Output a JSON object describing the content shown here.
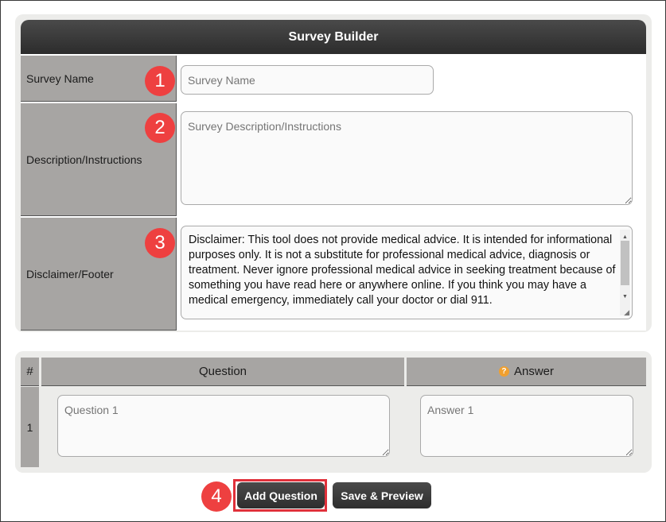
{
  "builder": {
    "title": "Survey Builder",
    "survey_name": {
      "label": "Survey Name",
      "placeholder": "Survey Name",
      "value": "",
      "badge": "1"
    },
    "description": {
      "label": "Description/Instructions",
      "placeholder": "Survey Description/Instructions",
      "value": "",
      "badge": "2"
    },
    "disclaimer": {
      "label": "Disclaimer/Footer",
      "badge": "3",
      "value": "Disclaimer: This tool does not provide medical advice. It is intended for informational purposes only. It is not a substitute for professional medical advice, diagnosis or treatment. Never ignore professional medical advice in seeking treatment because of something you have read here or anywhere online. If you think you may have a medical emergency, immediately call your doctor or dial 911."
    }
  },
  "questions": {
    "headers": {
      "number": "#",
      "question": "Question",
      "answer": "Answer"
    },
    "rows": [
      {
        "number": "1",
        "question_placeholder": "Question 1",
        "answer_placeholder": "Answer 1"
      }
    ]
  },
  "actions": {
    "badge": "4",
    "add_question": "Add Question",
    "save_preview": "Save & Preview"
  },
  "colors": {
    "header_bg": "#2c2c2c",
    "label_bg": "#a7a5a3",
    "badge": "#ee4040",
    "help_icon": "#f0a030",
    "highlight_border": "#e0303a"
  }
}
